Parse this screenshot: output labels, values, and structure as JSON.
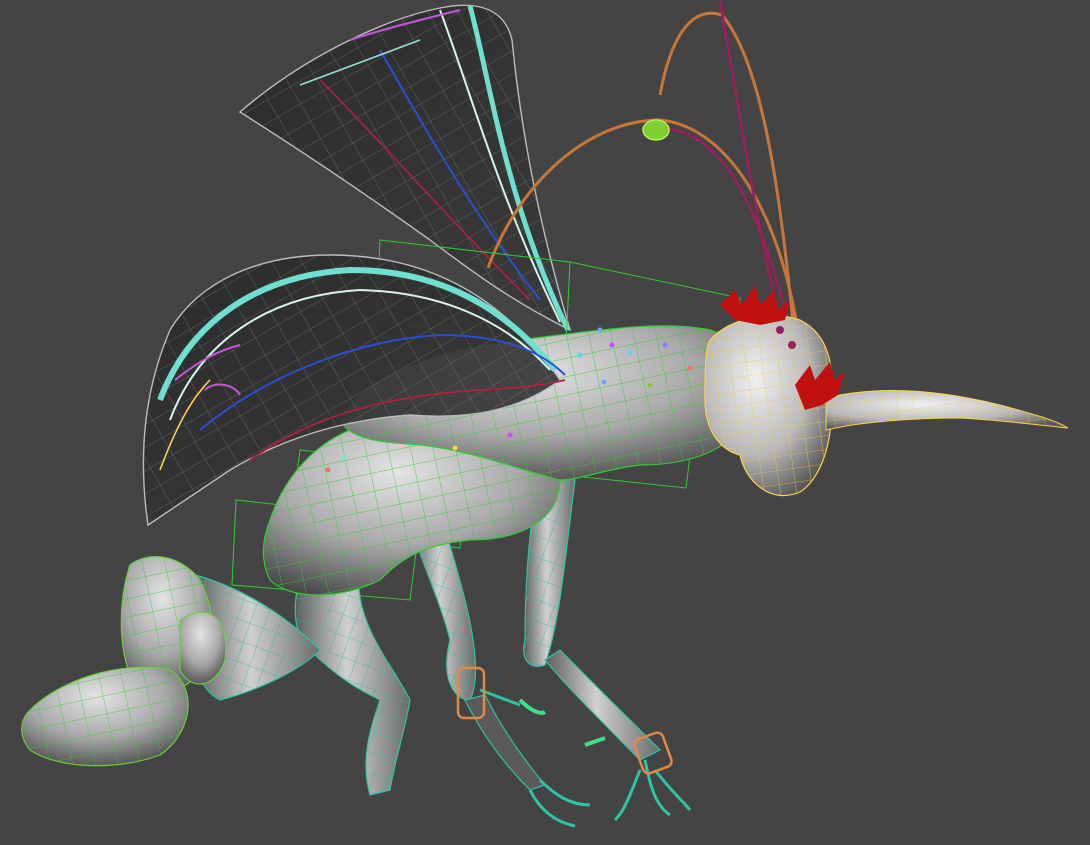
{
  "viewport": {
    "background": "#444444"
  },
  "scene": {
    "subject": "insect-character-rig",
    "selected_object_colors": {
      "body_wire": "#33cc33",
      "head_wire": "#ffd24d",
      "leg_wire": "#2fc4a6",
      "wing_wire": "#7fe3d6",
      "antenna_orange": "#c8773a",
      "antenna_magenta": "#9c1f5c",
      "tuft_red": "#c01010",
      "foot_orange": "#e08a4a",
      "bulb_green": "#7fcc33"
    }
  }
}
